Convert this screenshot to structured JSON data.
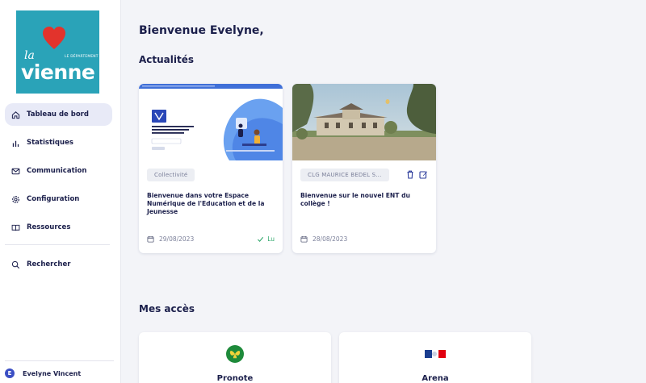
{
  "brand": {
    "logo_small": "la",
    "logo_tag": "Le département",
    "logo_main": "vienne",
    "colors": {
      "teal": "#2aa3b8",
      "red": "#e2332c"
    }
  },
  "nav": {
    "items": [
      {
        "label": "Tableau de bord",
        "icon": "home-icon",
        "active": true
      },
      {
        "label": "Statistiques",
        "icon": "bar-chart-icon",
        "active": false
      },
      {
        "label": "Communication",
        "icon": "mail-icon",
        "active": false
      },
      {
        "label": "Configuration",
        "icon": "gear-icon",
        "active": false
      },
      {
        "label": "Ressources",
        "icon": "book-icon",
        "active": false
      }
    ],
    "search_label": "Rechercher"
  },
  "user": {
    "initial": "E",
    "name": "Evelyne Vincent"
  },
  "main": {
    "welcome": "Bienvenue Evelyne,",
    "news_title": "Actualités",
    "access_title": "Mes accès"
  },
  "news": [
    {
      "chip": "Collectivité",
      "title": "Bienvenue dans votre Espace Numérique de l'Education et de la Jeunesse",
      "date": "29/08/2023",
      "status": "Lu"
    },
    {
      "chip": "CLG MAURICE BEDEL S...",
      "title": "Bienvenue sur le nouvel ENT du collège !",
      "date": "28/08/2023"
    }
  ],
  "accesses": [
    {
      "label": "Pronote",
      "icon": "pronote-logo-icon"
    },
    {
      "label": "Arena",
      "icon": "marianne-logo-icon"
    }
  ]
}
